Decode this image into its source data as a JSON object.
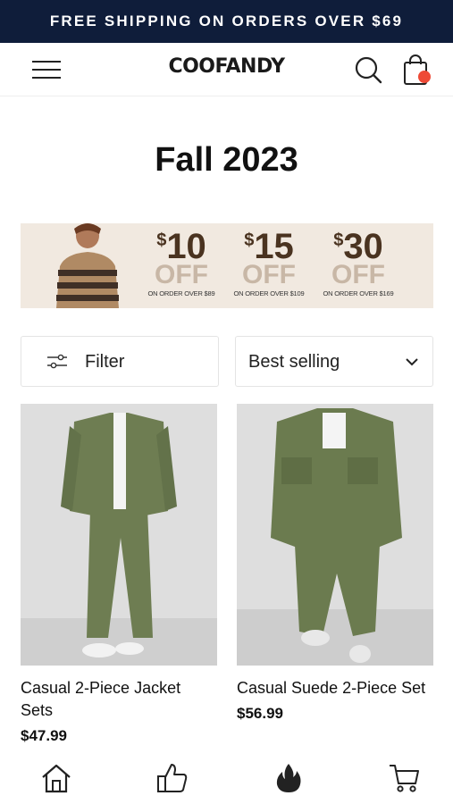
{
  "announcement": "FREE SHIPPING ON ORDERS OVER $69",
  "header": {
    "logo": "COOFANDY",
    "icons": [
      "menu-icon",
      "search-icon",
      "bag-icon"
    ],
    "badge_color": "#ee4a36"
  },
  "page": {
    "title": "Fall 2023"
  },
  "banner": {
    "offers": [
      {
        "currency": "$",
        "amount": "10",
        "off": "OFF",
        "condition": "ON ORDER OVER $89"
      },
      {
        "currency": "$",
        "amount": "15",
        "off": "OFF",
        "condition": "ON ORDER OVER $109"
      },
      {
        "currency": "$",
        "amount": "30",
        "off": "OFF",
        "condition": "ON ORDER OVER $169"
      }
    ]
  },
  "controls": {
    "filter_label": "Filter",
    "sort_label": "Best selling"
  },
  "products": [
    {
      "name": "Casual 2-Piece Jacket Sets",
      "price": "$47.99"
    },
    {
      "name": "Casual Suede 2-Piece Set",
      "price": "$56.99"
    }
  ],
  "bottom_nav": {
    "icons": [
      "home-icon",
      "thumbs-up-icon",
      "flame-icon",
      "cart-icon"
    ]
  },
  "colors": {
    "announce_bg": "#0f1d3a",
    "banner_bg": "#f1e9e0",
    "olive": "#6b7b4f"
  }
}
